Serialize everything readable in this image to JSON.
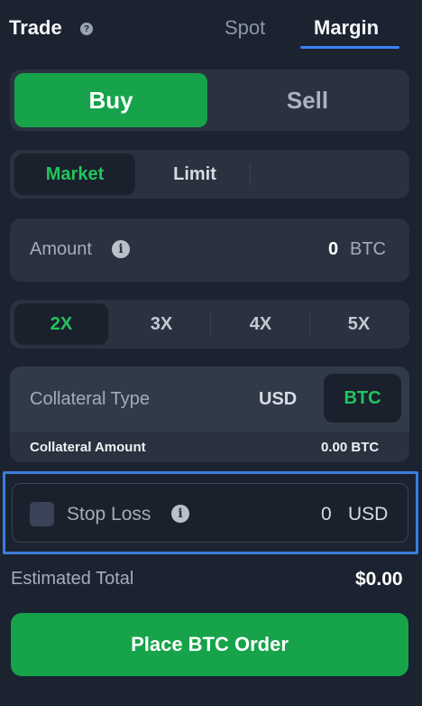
{
  "header": {
    "title": "Trade",
    "help_icon": "?",
    "tabs": [
      {
        "label": "Spot",
        "active": false
      },
      {
        "label": "Margin",
        "active": true
      }
    ]
  },
  "side": {
    "buy_label": "Buy",
    "sell_label": "Sell",
    "selected": "Buy"
  },
  "order_type": {
    "market_label": "Market",
    "limit_label": "Limit",
    "selected": "Market"
  },
  "amount": {
    "label": "Amount",
    "info_icon": "i",
    "value": "0",
    "unit": "BTC"
  },
  "leverage": {
    "options": [
      "2X",
      "3X",
      "4X",
      "5X"
    ],
    "selected": "2X"
  },
  "collateral": {
    "type_label": "Collateral Type",
    "options": [
      "USD",
      "BTC"
    ],
    "selected": "BTC",
    "amount_label": "Collateral Amount",
    "amount_value": "0.00 BTC"
  },
  "stop_loss": {
    "label": "Stop Loss",
    "info_icon": "i",
    "checked": false,
    "value": "0",
    "unit": "USD"
  },
  "total": {
    "label": "Estimated Total",
    "value": "$0.00"
  },
  "place_order": {
    "label": "Place BTC Order"
  },
  "colors": {
    "background": "#1b2331",
    "panel": "#2a3240",
    "accent_green": "#16a34a",
    "active_text_green": "#22c55e",
    "tab_underline": "#3b82f6",
    "highlight_outline": "#3d7ddb"
  }
}
